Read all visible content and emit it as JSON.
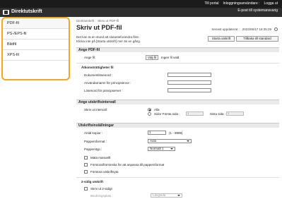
{
  "topbar": {
    "portal": "Till portal",
    "login_user": "Inloggningsanvändare :",
    "logout": "Logga ut"
  },
  "header": {
    "title": "Direktutskrift",
    "email": "E-post till systemansvarig"
  },
  "sidebar": {
    "items": [
      {
        "label": "PDF-fil"
      },
      {
        "label": "PS-/EPS-fil"
      },
      {
        "label": "Bildfil"
      },
      {
        "label": "XPS-fil"
      }
    ]
  },
  "breadcrumb": {
    "home": "Direktutskrift",
    "current": "Skriv ut PDF-fil"
  },
  "page": {
    "title": "Skriv ut PDF-fil",
    "updated_label": "Senast uppdaterat :",
    "updated_value": "2023/06/17 18:35:29",
    "desc_line1": "Det kan ta en stund att slutanteforandra filen",
    "desc_line2": "Klicka inte på [Starta utskrift] mer än en gång.",
    "start_button": "Starta utskrift",
    "back_button": "Tillbaka till standard"
  },
  "pdf_section": {
    "heading": "Ange PDF-fil",
    "file_label": "Ange fil:",
    "choose_button": "Välj fil",
    "no_file": "Ingen fil vald",
    "access_heading": "Åtkomsträttigheter fil",
    "doc_password": "Dokumentlösenord :",
    "user_name": "Användarnamn för principservor :",
    "policy_password": "Lösenord för principserver :"
  },
  "range_section": {
    "heading": "Ange utskriftsintervall",
    "print_range_label": "Skriv ut intervall:",
    "all_label": "Alla",
    "pages_label": "Sidor Första sida :",
    "first_page": "1",
    "last_label": "Sista sida :",
    "last_page": "1"
  },
  "settings_section": {
    "heading": "Utskriftsinställningar",
    "copies_label": "Antal kopior :",
    "copies_value": "1",
    "copies_range": "(1 - 9999)",
    "paper_size_label": "Pappersformat :",
    "paper_size_value": "Auto",
    "paper_type_label": "Papperstyp :",
    "paper_type_value": "Normalt 1",
    "fit_label": "Mata manuellt",
    "reduce_label": "Förstora/förminska för att anpassa till pappersformat",
    "enlarge_label": "Förstora utskriftsyta",
    "duplex_heading": "2-sidig utskrift",
    "duplex_label": "Skriv ut 2-sidigt",
    "binding_label": "Bindningsplats :",
    "binding_value": "Långsida"
  }
}
